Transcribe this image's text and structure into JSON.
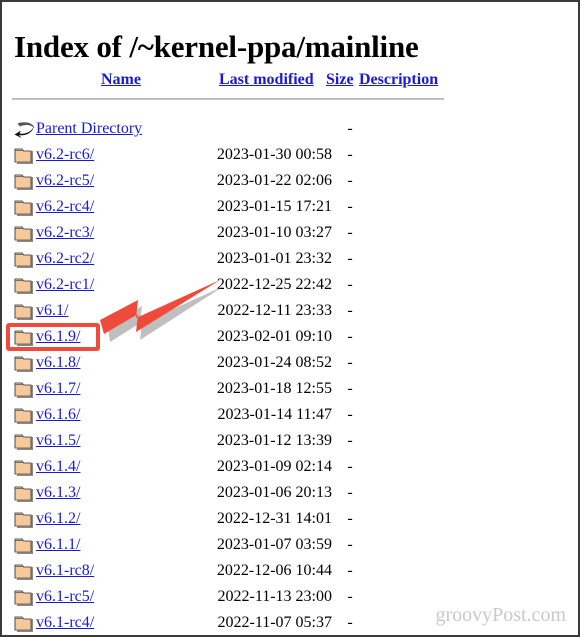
{
  "page": {
    "title": "Index of /~kernel-ppa/mainline",
    "watermark": "groovyPost.com"
  },
  "columns": {
    "name": "Name",
    "last_modified": "Last modified",
    "size": "Size",
    "description": "Description"
  },
  "colors": {
    "link": "#1919d6",
    "text": "#000000",
    "annotation_red": "#ef4b3d",
    "rule": "#c8c8c8",
    "watermark": "#c9c9c9",
    "folder_body": "#f5c99a",
    "folder_outline": "#5a5a5a"
  },
  "rows": [
    {
      "icon": "parent-directory-icon",
      "name": "Parent Directory",
      "last_modified": "",
      "size": "-",
      "description": "",
      "highlighted": false
    },
    {
      "icon": "folder-icon",
      "name": "v6.2-rc6/",
      "last_modified": "2023-01-30 00:58",
      "size": "-",
      "description": "",
      "highlighted": false
    },
    {
      "icon": "folder-icon",
      "name": "v6.2-rc5/",
      "last_modified": "2023-01-22 02:06",
      "size": "-",
      "description": "",
      "highlighted": false
    },
    {
      "icon": "folder-icon",
      "name": "v6.2-rc4/",
      "last_modified": "2023-01-15 17:21",
      "size": "-",
      "description": "",
      "highlighted": false
    },
    {
      "icon": "folder-icon",
      "name": "v6.2-rc3/",
      "last_modified": "2023-01-10 03:27",
      "size": "-",
      "description": "",
      "highlighted": false
    },
    {
      "icon": "folder-icon",
      "name": "v6.2-rc2/",
      "last_modified": "2023-01-01 23:32",
      "size": "-",
      "description": "",
      "highlighted": false
    },
    {
      "icon": "folder-icon",
      "name": "v6.2-rc1/",
      "last_modified": "2022-12-25 22:42",
      "size": "-",
      "description": "",
      "highlighted": false
    },
    {
      "icon": "folder-icon",
      "name": "v6.1/",
      "last_modified": "2022-12-11 23:33",
      "size": "-",
      "description": "",
      "highlighted": false
    },
    {
      "icon": "folder-icon",
      "name": "v6.1.9/",
      "last_modified": "2023-02-01 09:10",
      "size": "-",
      "description": "",
      "highlighted": true
    },
    {
      "icon": "folder-icon",
      "name": "v6.1.8/",
      "last_modified": "2023-01-24 08:52",
      "size": "-",
      "description": "",
      "highlighted": false
    },
    {
      "icon": "folder-icon",
      "name": "v6.1.7/",
      "last_modified": "2023-01-18 12:55",
      "size": "-",
      "description": "",
      "highlighted": false
    },
    {
      "icon": "folder-icon",
      "name": "v6.1.6/",
      "last_modified": "2023-01-14 11:47",
      "size": "-",
      "description": "",
      "highlighted": false
    },
    {
      "icon": "folder-icon",
      "name": "v6.1.5/",
      "last_modified": "2023-01-12 13:39",
      "size": "-",
      "description": "",
      "highlighted": false
    },
    {
      "icon": "folder-icon",
      "name": "v6.1.4/",
      "last_modified": "2023-01-09 02:14",
      "size": "-",
      "description": "",
      "highlighted": false
    },
    {
      "icon": "folder-icon",
      "name": "v6.1.3/",
      "last_modified": "2023-01-06 20:13",
      "size": "-",
      "description": "",
      "highlighted": false
    },
    {
      "icon": "folder-icon",
      "name": "v6.1.2/",
      "last_modified": "2022-12-31 14:01",
      "size": "-",
      "description": "",
      "highlighted": false
    },
    {
      "icon": "folder-icon",
      "name": "v6.1.1/",
      "last_modified": "2023-01-07 03:59",
      "size": "-",
      "description": "",
      "highlighted": false
    },
    {
      "icon": "folder-icon",
      "name": "v6.1-rc8/",
      "last_modified": "2022-12-06 10:44",
      "size": "-",
      "description": "",
      "highlighted": false
    },
    {
      "icon": "folder-icon",
      "name": "v6.1-rc5/",
      "last_modified": "2022-11-13 23:00",
      "size": "-",
      "description": "",
      "highlighted": false
    },
    {
      "icon": "folder-icon",
      "name": "v6.1-rc4/",
      "last_modified": "2022-11-07 05:37",
      "size": "-",
      "description": "",
      "highlighted": false
    }
  ],
  "annotations": {
    "highlight_target": "v6.1.9/",
    "arrow_color": "#ef4b3d",
    "arrow_direction": "down-left"
  }
}
